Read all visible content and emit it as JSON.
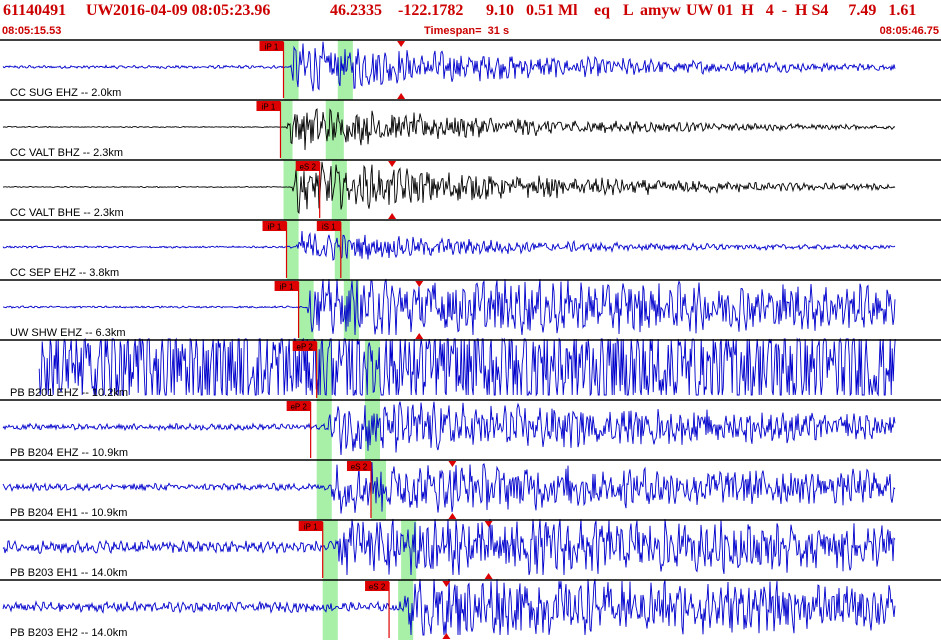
{
  "header": {
    "event_id": "61140491",
    "network": "UW",
    "origin_time": "2016-04-09 08:05:23.96",
    "latitude": "46.2335",
    "longitude": "-122.1782",
    "depth": "9.10",
    "magnitude": "0.51 Ml",
    "event_type": "eq",
    "flag": "L",
    "analyst": "amyw",
    "summary_right": "UW 01  H   4  -  H S4     7.49   1.61",
    "start_time": "08:05:15.53",
    "timespan_label": "Timespan=  31 s",
    "end_time": "08:05:46.75"
  },
  "colors": {
    "header_red": "#cc0000",
    "trace_blue": "#0000cc",
    "trace_black": "#000000",
    "pick_red": "#dd0000",
    "window_green": "#a8f0a8",
    "separator": "#000000"
  },
  "chart_data": {
    "type": "waveform",
    "x_unit": "s",
    "xlim": [
      0,
      31
    ],
    "traces": [
      {
        "label": "CC SUG EHZ -- 2.0km",
        "color": "blue",
        "amp": "medium",
        "onset": 9.5,
        "noise": 0.03,
        "picks": [
          {
            "label": "iP 1",
            "t": 9.3
          }
        ],
        "s_marker_t": 13.2,
        "greens": [
          [
            9.3,
            9.8
          ],
          [
            11.1,
            11.6
          ]
        ],
        "sig": 0.5,
        "decay": 0.12
      },
      {
        "label": "CC VALT BHZ -- 2.3km",
        "color": "black",
        "amp": "medium",
        "onset": 9.4,
        "noise": 0.01,
        "picks": [
          {
            "label": "iP 1",
            "t": 9.2
          }
        ],
        "s_marker_t": null,
        "greens": [
          [
            9.2,
            9.6
          ],
          [
            10.7,
            11.3
          ]
        ],
        "sig": 0.45,
        "decay": 0.13
      },
      {
        "label": "CC VALT BHE -- 2.3km",
        "color": "black",
        "amp": "large",
        "onset": 9.6,
        "noise": 0.01,
        "picks": [
          {
            "label": "eS 2",
            "t": 10.5
          }
        ],
        "s_marker_t": 12.9,
        "greens": [
          [
            9.3,
            9.8
          ],
          [
            10.9,
            11.4
          ]
        ],
        "sig": 0.55,
        "decay": 0.12
      },
      {
        "label": "CC SEP EHZ -- 3.8km",
        "color": "blue",
        "amp": "small",
        "onset": 9.7,
        "noise": 0.02,
        "picks": [
          {
            "label": "iP 1",
            "t": 9.4
          },
          {
            "label": "iS 1",
            "t": 11.2
          }
        ],
        "s_marker_t": null,
        "greens": [
          [
            9.4,
            9.8
          ],
          [
            11.0,
            11.5
          ]
        ],
        "sig": 0.3,
        "decay": 0.14
      },
      {
        "label": "UW SHW EHZ -- 6.3km",
        "color": "blue",
        "amp": "large",
        "onset": 10.1,
        "noise": 0.02,
        "picks": [
          {
            "label": "iP 1",
            "t": 9.8
          }
        ],
        "s_marker_t": 13.8,
        "greens": [
          [
            9.8,
            10.3
          ],
          [
            11.3,
            11.8
          ]
        ],
        "sig": 0.6,
        "decay": 0.02
      },
      {
        "label": "PB B201 EHZ -- 10.2km",
        "color": "blue",
        "amp": "large",
        "onset": 1.0,
        "noise": 0.45,
        "picks": [
          {
            "label": "eP 2",
            "t": 10.4
          }
        ],
        "s_marker_t": null,
        "greens": [
          [
            10.4,
            10.9
          ],
          [
            12.0,
            12.5
          ]
        ],
        "sig": 0.55,
        "decay": 0.0
      },
      {
        "label": "PB B204 EHZ -- 10.9km",
        "color": "blue",
        "amp": "medium",
        "onset": 10.8,
        "noise": 0.06,
        "picks": [
          {
            "label": "eP 2",
            "t": 10.2
          }
        ],
        "s_marker_t": null,
        "greens": [
          [
            10.4,
            10.9
          ],
          [
            12.0,
            12.5
          ]
        ],
        "sig": 0.5,
        "decay": 0.05
      },
      {
        "label": "PB B204 EH1 -- 10.9km",
        "color": "blue",
        "amp": "medium",
        "onset": 10.9,
        "noise": 0.07,
        "picks": [
          {
            "label": "eS 2",
            "t": 12.2
          }
        ],
        "s_marker_t": 14.9,
        "greens": [
          [
            10.4,
            10.9
          ],
          [
            12.2,
            12.7
          ]
        ],
        "sig": 0.45,
        "decay": 0.03
      },
      {
        "label": "PB B203 EH1 -- 14.0km",
        "color": "blue",
        "amp": "large",
        "onset": 11.1,
        "noise": 0.12,
        "picks": [
          {
            "label": "iP 1",
            "t": 10.6
          }
        ],
        "s_marker_t": 16.1,
        "greens": [
          [
            10.6,
            11.1
          ],
          [
            13.2,
            13.7
          ]
        ],
        "sig": 0.55,
        "decay": 0.03
      },
      {
        "label": "PB B203 EH2 -- 14.0km",
        "color": "blue",
        "amp": "large",
        "onset": 13.3,
        "noise": 0.1,
        "picks": [
          {
            "label": "eS 2",
            "t": 12.8
          }
        ],
        "s_marker_t": 14.7,
        "greens": [
          [
            10.6,
            11.1
          ],
          [
            13.1,
            13.6
          ]
        ],
        "sig": 0.55,
        "decay": 0.03
      }
    ]
  }
}
